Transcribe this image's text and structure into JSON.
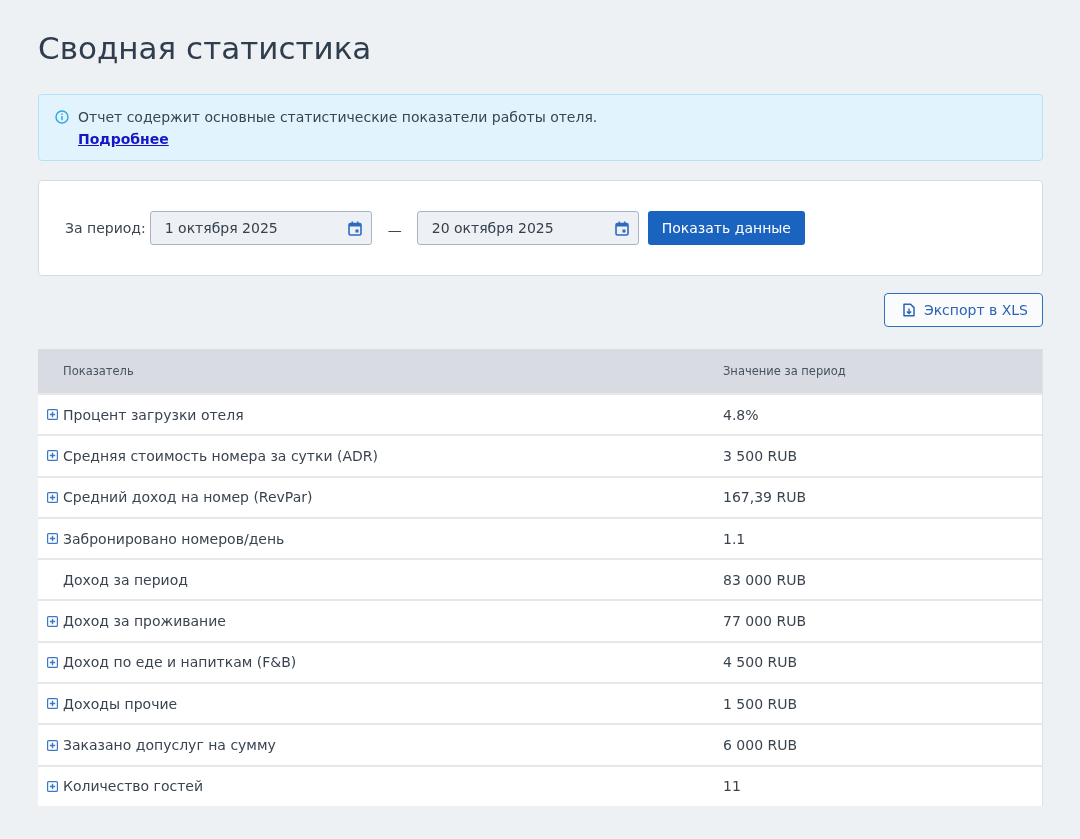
{
  "page": {
    "title": "Сводная статистика"
  },
  "info_banner": {
    "text": "Отчет содержит основные статистические показатели работы отеля.",
    "link": "Подробнее"
  },
  "filter": {
    "label": "За период:",
    "date_from": "1 октября 2025",
    "separator": "—",
    "date_to": "20 октября 2025",
    "submit_button": "Показать данные"
  },
  "export_button": "Экспорт в XLS",
  "table": {
    "columns": [
      "Показатель",
      "Значение за период"
    ],
    "rows": [
      {
        "label": "Процент загрузки отеля",
        "value": "4.8%",
        "expandable": true
      },
      {
        "label": "Средняя стоимость номера за сутки (ADR)",
        "value": "3 500 RUB",
        "expandable": true
      },
      {
        "label": "Средний доход на номер (RevPar)",
        "value": "167,39 RUB",
        "expandable": true
      },
      {
        "label": "Забронировано номеров/день",
        "value": "1.1",
        "expandable": true
      },
      {
        "label": "Доход за период",
        "value": "83 000 RUB",
        "expandable": false
      },
      {
        "label": "Доход за проживание",
        "value": "77 000 RUB",
        "expandable": true
      },
      {
        "label": "Доход по еде и напиткам (F&B)",
        "value": "4 500 RUB",
        "expandable": true
      },
      {
        "label": "Доходы прочие",
        "value": "1 500 RUB",
        "expandable": true
      },
      {
        "label": "Заказано допуслуг на сумму",
        "value": "6 000 RUB",
        "expandable": true
      },
      {
        "label": "Количество гостей",
        "value": "11",
        "expandable": true
      }
    ]
  }
}
